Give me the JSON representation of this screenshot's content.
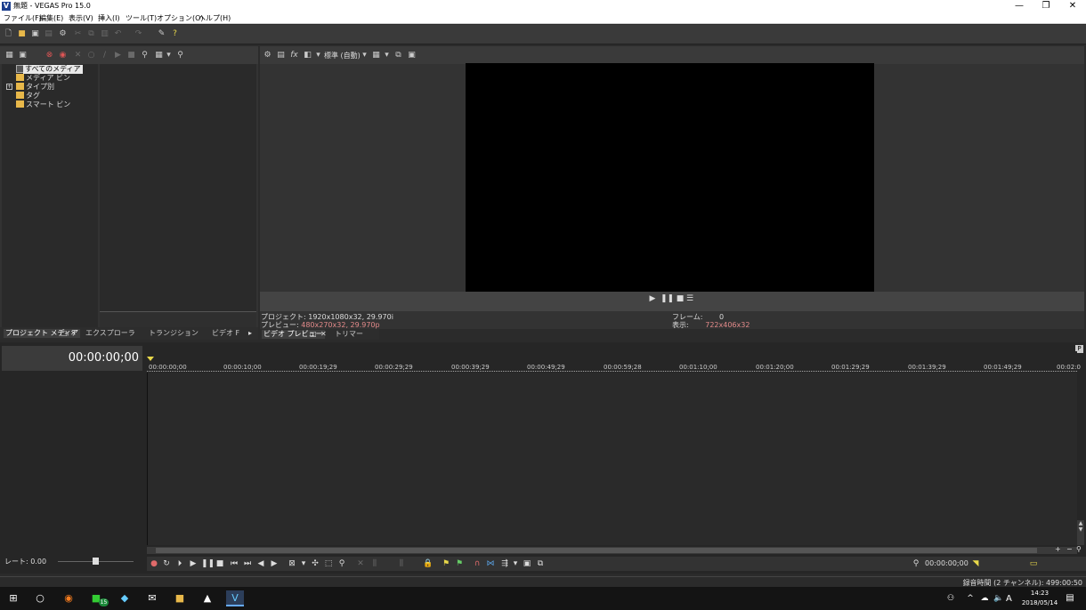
{
  "window": {
    "title": "無題 - VEGAS Pro 15.0",
    "logo": "V"
  },
  "menu": [
    "ファイル(F)",
    "編集(E)",
    "表示(V)",
    "挿入(I)",
    "ツール(T)",
    "オプション(O)",
    "ヘルプ(H)"
  ],
  "tree": {
    "selected": "すべてのメディア",
    "items": [
      "メディア ビン",
      "タイプ別",
      "タグ",
      "スマート ビン"
    ]
  },
  "left_tabs": {
    "project_media": "プロジェクト メディア",
    "explorer": "エクスプローラ",
    "transitions": "トランジション",
    "video_fx": "ビデオ F"
  },
  "preview": {
    "quality": "標準 (自動)",
    "project_label": "プロジェクト:",
    "project_value": "1920x1080x32, 29.970i",
    "preview_label": "プレビュー:",
    "preview_value": "480x270x32, 29.970p",
    "frame_label": "フレーム:",
    "frame_value": "0",
    "display_label": "表示:",
    "display_value": "722x406x32",
    "tab_preview": "ビデオ プレビュー",
    "tab_trimmer": "トリマー"
  },
  "timeline": {
    "timecode": "00:00:00;00",
    "ruler": [
      "00:00:00;00",
      "00:00:10;00",
      "00:00:19;29",
      "00:00:29;29",
      "00:00:39;29",
      "00:00:49;29",
      "00:00:59;28",
      "00:01:10;00",
      "00:01:20;00",
      "00:01:29;29",
      "00:01:39;29",
      "00:01:49;29",
      "00:02:0"
    ],
    "rate": "レート: 0.00",
    "cursor_time": "00:00:00;00"
  },
  "status": {
    "record_time": "録音時間 (2 チャンネル): 499:00:50"
  },
  "taskbar": {
    "time": "14:23",
    "date": "2018/05/14",
    "ime": "A",
    "badge": "15"
  }
}
